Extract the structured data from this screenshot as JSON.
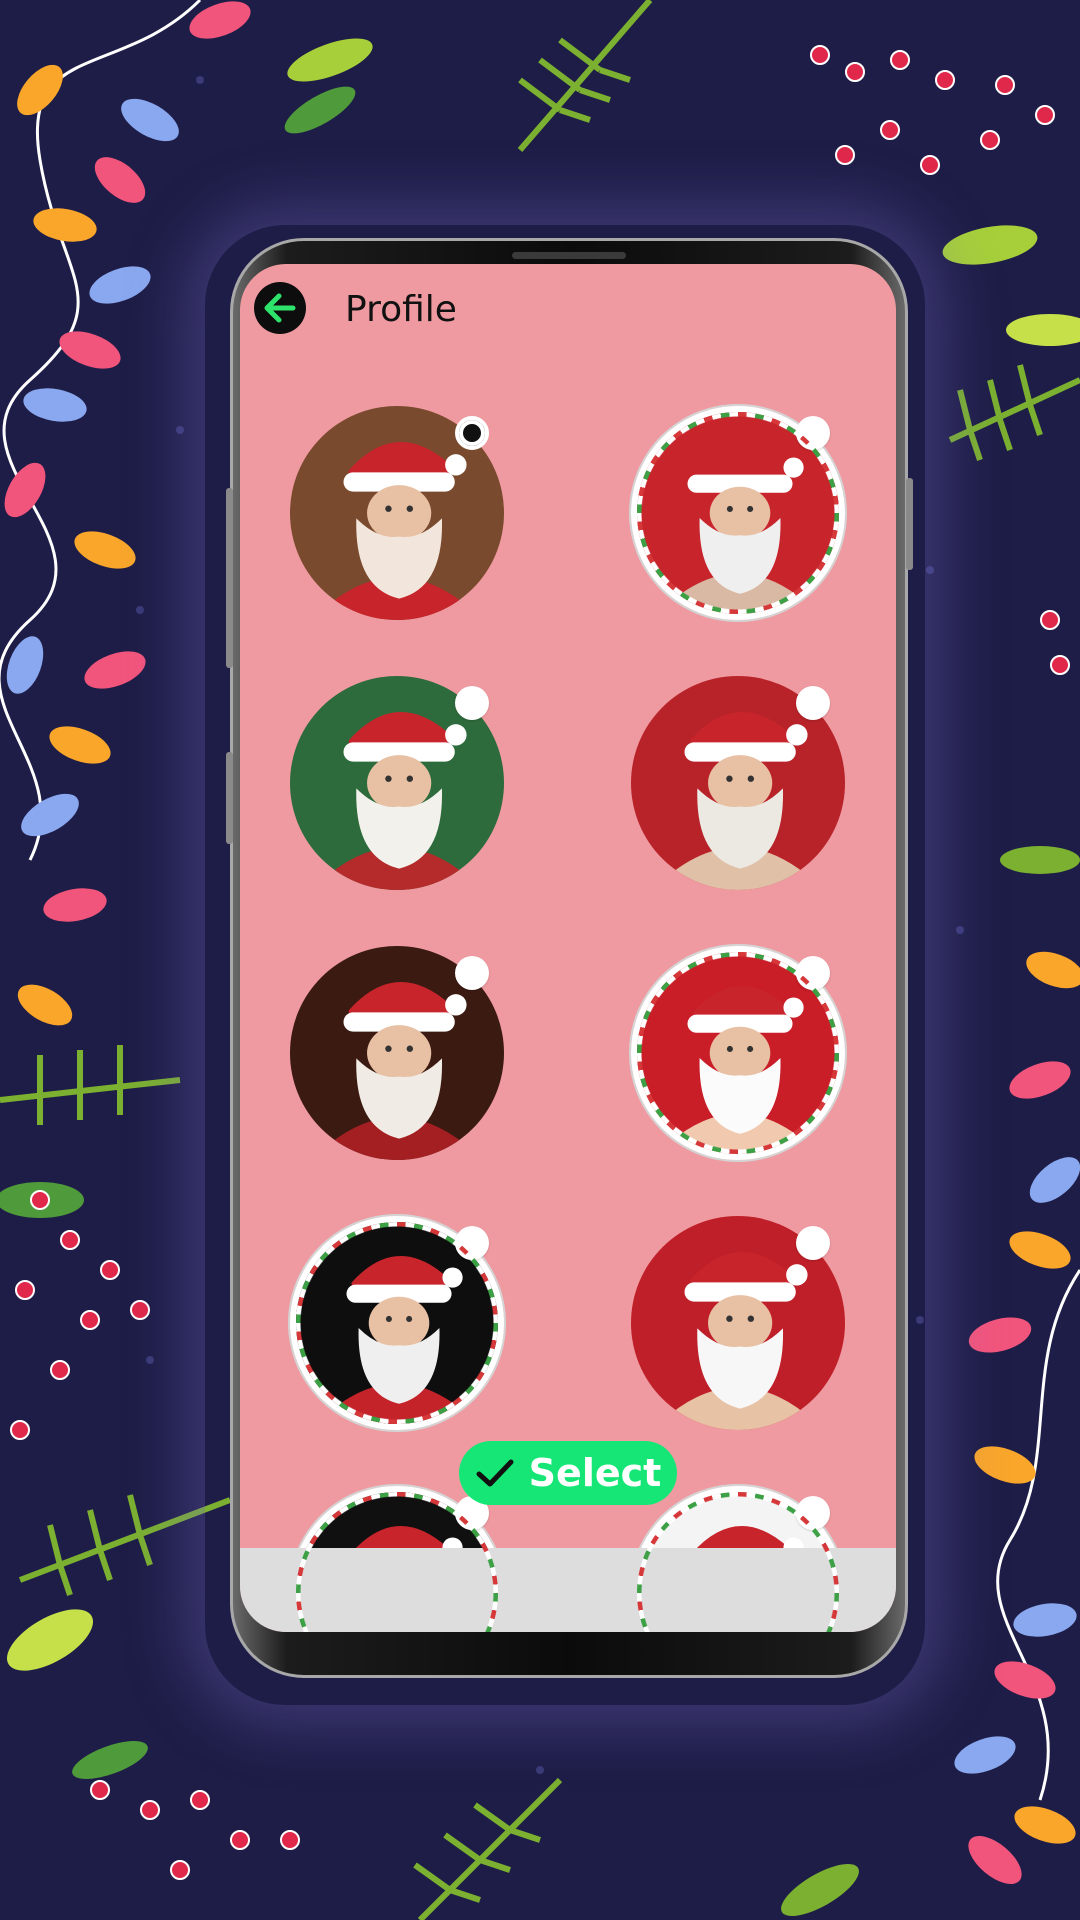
{
  "header": {
    "title": "Profile",
    "back_icon": "arrow-left-icon"
  },
  "profiles": [
    {
      "label": "santa-dj",
      "selected": true,
      "framed": false,
      "palette": [
        "#7a4a2e",
        "#f2e6dc",
        "#c8242b"
      ]
    },
    {
      "label": "santa-closeup",
      "selected": false,
      "framed": true,
      "palette": [
        "#c8242b",
        "#efefef",
        "#d9b9a3"
      ]
    },
    {
      "label": "santa-green-vest",
      "selected": false,
      "framed": false,
      "palette": [
        "#2e6b3c",
        "#f3f1ec",
        "#b52a2a"
      ]
    },
    {
      "label": "santa-waving",
      "selected": false,
      "framed": false,
      "palette": [
        "#b8232a",
        "#ece8e2",
        "#e1c0a8"
      ]
    },
    {
      "label": "santa-fireplace",
      "selected": false,
      "framed": false,
      "palette": [
        "#3b1a12",
        "#f0ebe4",
        "#a41f22"
      ]
    },
    {
      "label": "santa-surprised",
      "selected": false,
      "framed": true,
      "palette": [
        "#c91d27",
        "#fbfbfb",
        "#f0c9ae"
      ]
    },
    {
      "label": "santa-thinking",
      "selected": false,
      "framed": true,
      "palette": [
        "#0e0e0e",
        "#efefef",
        "#c4232a"
      ]
    },
    {
      "label": "santa-cheerful",
      "selected": false,
      "framed": false,
      "palette": [
        "#bf1f28",
        "#f7f7f7",
        "#e8c2a5"
      ]
    },
    {
      "label": "santa-partial-1",
      "selected": false,
      "framed": true,
      "palette": [
        "#101010",
        "#f0f0f0",
        "#c62828"
      ]
    },
    {
      "label": "santa-partial-2",
      "selected": false,
      "framed": true,
      "palette": [
        "#f4f4f4",
        "#e9e9e9",
        "#c62828"
      ]
    }
  ],
  "select_button": {
    "label": "Select",
    "icon": "checkmark-icon",
    "color": "#15e676"
  },
  "colors": {
    "screen_background": "#ef9aa0",
    "page_background": "#1e1d47",
    "bottom_bar": "#dddddd"
  }
}
